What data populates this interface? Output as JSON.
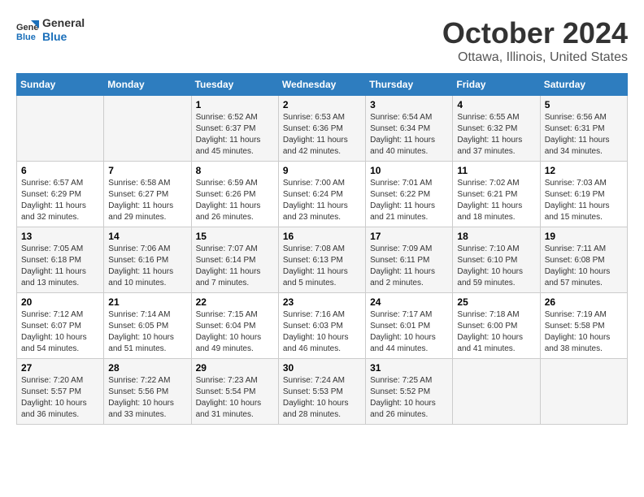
{
  "header": {
    "logo_general": "General",
    "logo_blue": "Blue",
    "month_title": "October 2024",
    "location": "Ottawa, Illinois, United States"
  },
  "weekdays": [
    "Sunday",
    "Monday",
    "Tuesday",
    "Wednesday",
    "Thursday",
    "Friday",
    "Saturday"
  ],
  "weeks": [
    [
      {
        "day": "",
        "info": ""
      },
      {
        "day": "",
        "info": ""
      },
      {
        "day": "1",
        "info": "Sunrise: 6:52 AM\nSunset: 6:37 PM\nDaylight: 11 hours and 45 minutes."
      },
      {
        "day": "2",
        "info": "Sunrise: 6:53 AM\nSunset: 6:36 PM\nDaylight: 11 hours and 42 minutes."
      },
      {
        "day": "3",
        "info": "Sunrise: 6:54 AM\nSunset: 6:34 PM\nDaylight: 11 hours and 40 minutes."
      },
      {
        "day": "4",
        "info": "Sunrise: 6:55 AM\nSunset: 6:32 PM\nDaylight: 11 hours and 37 minutes."
      },
      {
        "day": "5",
        "info": "Sunrise: 6:56 AM\nSunset: 6:31 PM\nDaylight: 11 hours and 34 minutes."
      }
    ],
    [
      {
        "day": "6",
        "info": "Sunrise: 6:57 AM\nSunset: 6:29 PM\nDaylight: 11 hours and 32 minutes."
      },
      {
        "day": "7",
        "info": "Sunrise: 6:58 AM\nSunset: 6:27 PM\nDaylight: 11 hours and 29 minutes."
      },
      {
        "day": "8",
        "info": "Sunrise: 6:59 AM\nSunset: 6:26 PM\nDaylight: 11 hours and 26 minutes."
      },
      {
        "day": "9",
        "info": "Sunrise: 7:00 AM\nSunset: 6:24 PM\nDaylight: 11 hours and 23 minutes."
      },
      {
        "day": "10",
        "info": "Sunrise: 7:01 AM\nSunset: 6:22 PM\nDaylight: 11 hours and 21 minutes."
      },
      {
        "day": "11",
        "info": "Sunrise: 7:02 AM\nSunset: 6:21 PM\nDaylight: 11 hours and 18 minutes."
      },
      {
        "day": "12",
        "info": "Sunrise: 7:03 AM\nSunset: 6:19 PM\nDaylight: 11 hours and 15 minutes."
      }
    ],
    [
      {
        "day": "13",
        "info": "Sunrise: 7:05 AM\nSunset: 6:18 PM\nDaylight: 11 hours and 13 minutes."
      },
      {
        "day": "14",
        "info": "Sunrise: 7:06 AM\nSunset: 6:16 PM\nDaylight: 11 hours and 10 minutes."
      },
      {
        "day": "15",
        "info": "Sunrise: 7:07 AM\nSunset: 6:14 PM\nDaylight: 11 hours and 7 minutes."
      },
      {
        "day": "16",
        "info": "Sunrise: 7:08 AM\nSunset: 6:13 PM\nDaylight: 11 hours and 5 minutes."
      },
      {
        "day": "17",
        "info": "Sunrise: 7:09 AM\nSunset: 6:11 PM\nDaylight: 11 hours and 2 minutes."
      },
      {
        "day": "18",
        "info": "Sunrise: 7:10 AM\nSunset: 6:10 PM\nDaylight: 10 hours and 59 minutes."
      },
      {
        "day": "19",
        "info": "Sunrise: 7:11 AM\nSunset: 6:08 PM\nDaylight: 10 hours and 57 minutes."
      }
    ],
    [
      {
        "day": "20",
        "info": "Sunrise: 7:12 AM\nSunset: 6:07 PM\nDaylight: 10 hours and 54 minutes."
      },
      {
        "day": "21",
        "info": "Sunrise: 7:14 AM\nSunset: 6:05 PM\nDaylight: 10 hours and 51 minutes."
      },
      {
        "day": "22",
        "info": "Sunrise: 7:15 AM\nSunset: 6:04 PM\nDaylight: 10 hours and 49 minutes."
      },
      {
        "day": "23",
        "info": "Sunrise: 7:16 AM\nSunset: 6:03 PM\nDaylight: 10 hours and 46 minutes."
      },
      {
        "day": "24",
        "info": "Sunrise: 7:17 AM\nSunset: 6:01 PM\nDaylight: 10 hours and 44 minutes."
      },
      {
        "day": "25",
        "info": "Sunrise: 7:18 AM\nSunset: 6:00 PM\nDaylight: 10 hours and 41 minutes."
      },
      {
        "day": "26",
        "info": "Sunrise: 7:19 AM\nSunset: 5:58 PM\nDaylight: 10 hours and 38 minutes."
      }
    ],
    [
      {
        "day": "27",
        "info": "Sunrise: 7:20 AM\nSunset: 5:57 PM\nDaylight: 10 hours and 36 minutes."
      },
      {
        "day": "28",
        "info": "Sunrise: 7:22 AM\nSunset: 5:56 PM\nDaylight: 10 hours and 33 minutes."
      },
      {
        "day": "29",
        "info": "Sunrise: 7:23 AM\nSunset: 5:54 PM\nDaylight: 10 hours and 31 minutes."
      },
      {
        "day": "30",
        "info": "Sunrise: 7:24 AM\nSunset: 5:53 PM\nDaylight: 10 hours and 28 minutes."
      },
      {
        "day": "31",
        "info": "Sunrise: 7:25 AM\nSunset: 5:52 PM\nDaylight: 10 hours and 26 minutes."
      },
      {
        "day": "",
        "info": ""
      },
      {
        "day": "",
        "info": ""
      }
    ]
  ]
}
